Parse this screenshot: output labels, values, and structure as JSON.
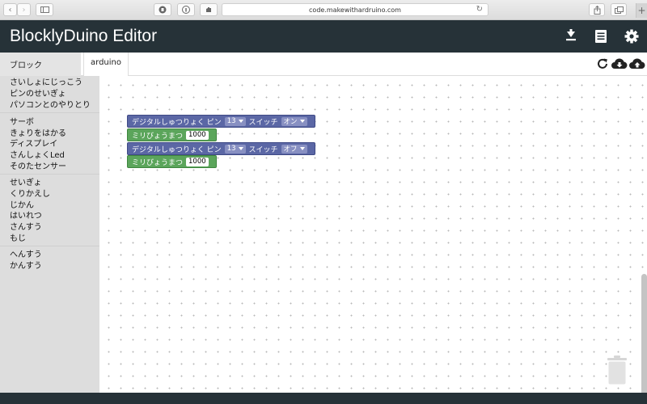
{
  "browser": {
    "url": "code.makewithardruino.com",
    "new_tab": "+"
  },
  "app": {
    "title": "BlocklyDuino Editor",
    "header_icons": [
      "download-icon",
      "list-icon",
      "settings-icon"
    ]
  },
  "tabs": {
    "blocks": "ブロック",
    "arduino": "arduino",
    "actions": [
      "refresh-icon",
      "cloud-download-icon",
      "cloud-upload-icon"
    ]
  },
  "sidebar": {
    "categories": [
      "さいしょにじっこう",
      "ピンのせいぎょ",
      "パソコンとのやりとり",
      "サーボ",
      "きょりをはかる",
      "ディスプレイ",
      "さんしょくLed",
      "そのたセンサー",
      "せいぎょ",
      "くりかえし",
      "じかん",
      "はいれつ",
      "さんすう",
      "もじ",
      "へんすう",
      "かんすう"
    ]
  },
  "blocks": [
    {
      "type": "digital-write",
      "label": "デジタルしゅつりょく ピン",
      "pin": "13",
      "switch_label": "スイッチ",
      "state": "オン"
    },
    {
      "type": "delay",
      "label": "ミリびょうまつ",
      "value": "1000"
    },
    {
      "type": "digital-write",
      "label": "デジタルしゅつりょく ピン",
      "pin": "13",
      "switch_label": "スイッチ",
      "state": "オフ"
    },
    {
      "type": "delay",
      "label": "ミリびょうまつ",
      "value": "1000"
    }
  ]
}
